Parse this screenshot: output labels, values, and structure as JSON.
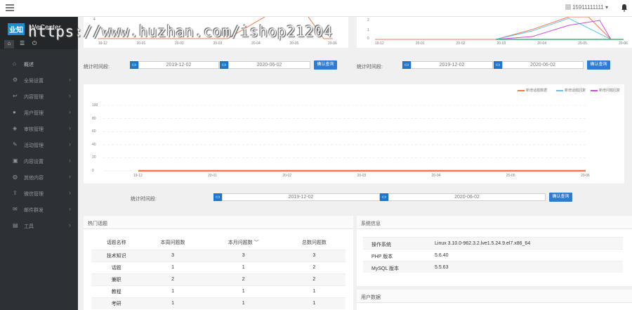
{
  "watermark": "https://www.huzhan.com/ishop21204",
  "brand": {
    "logo": "业知",
    "name": "WeCenter"
  },
  "user": {
    "name": "15911111111 ▾"
  },
  "sidebar": {
    "items": [
      {
        "label": "概述",
        "icon": "home-icon",
        "arrow": ""
      },
      {
        "label": "全局设置",
        "icon": "gear-icon",
        "arrow": "›"
      },
      {
        "label": "内容管理",
        "icon": "reply-icon",
        "arrow": "›"
      },
      {
        "label": "用户管理",
        "icon": "user-icon",
        "arrow": "›"
      },
      {
        "label": "审核管理",
        "icon": "shield-icon",
        "arrow": "›"
      },
      {
        "label": "活动管理",
        "icon": "edit-icon",
        "arrow": "›"
      },
      {
        "label": "内容设置",
        "icon": "trash-icon",
        "arrow": "›"
      },
      {
        "label": "其他内容",
        "icon": "globe-icon",
        "arrow": "›"
      },
      {
        "label": "微信管理",
        "icon": "share-icon",
        "arrow": "›"
      },
      {
        "label": "邮件群发",
        "icon": "mail-icon",
        "arrow": "›"
      },
      {
        "label": "工具",
        "icon": "toolbox-icon",
        "arrow": "›"
      }
    ]
  },
  "filters": {
    "label": "统计时间段:",
    "start": "2019-12-02",
    "end": "2020-06-02",
    "button": "确认查询"
  },
  "charts": {
    "top_left_ticks": [
      "19-12",
      "20-01",
      "20-02",
      "20-03",
      "20-04",
      "20-05",
      "20-06"
    ],
    "top_left_y": [
      "4"
    ],
    "top_right_ticks": [
      "19-12",
      "20-01",
      "20-02",
      "20-03",
      "20-04",
      "20-05",
      "20-06"
    ],
    "top_right_y": [
      "2",
      "1",
      "0"
    ],
    "main_y": [
      "100",
      "80",
      "60",
      "40",
      "20",
      "0"
    ],
    "main_x": [
      "19-12",
      "20-01",
      "20-02",
      "20-03",
      "20-04",
      "20-05",
      "20-06"
    ],
    "legend": [
      "新增话题数据",
      "新增话题回复",
      "新增问题回复"
    ],
    "colors": {
      "orange": "#f2784b",
      "cyan": "#62c3e8",
      "purple": "#c44fd0",
      "green": "#3cb371"
    }
  },
  "chart_data": {
    "type": "line",
    "categories": [
      "19-12",
      "20-01",
      "20-02",
      "20-03",
      "20-04",
      "20-05",
      "20-06"
    ],
    "series": [
      {
        "name": "新增话题数据",
        "values": [
          0,
          0,
          0,
          0,
          0,
          0,
          0
        ]
      },
      {
        "name": "新增话题回复",
        "values": [
          0,
          0,
          0,
          0,
          0,
          0,
          0
        ]
      },
      {
        "name": "新增问题回复",
        "values": [
          0,
          0,
          0,
          0,
          0,
          0,
          0
        ]
      }
    ],
    "ylim": [
      0,
      100
    ]
  },
  "hot_topics": {
    "title": "热门话题",
    "headers": [
      "话题名称",
      "本周问题数",
      "本月问题数 ﹀",
      "总数问题数"
    ],
    "rows": [
      [
        "技术知识",
        "3",
        "3",
        "3"
      ],
      [
        "话题",
        "1",
        "1",
        "2"
      ],
      [
        "兼职",
        "2",
        "2",
        "2"
      ],
      [
        "教程",
        "1",
        "1",
        "1"
      ],
      [
        "考研",
        "1",
        "1",
        "1"
      ]
    ]
  },
  "system": {
    "title": "系统信息",
    "rows": [
      {
        "k": "操作系统",
        "v": "Linux 3.10.0-962.3.2.lve1.5.24.9.el7.x86_64"
      },
      {
        "k": "PHP 版本",
        "v": "5.6.40"
      },
      {
        "k": "MySQL 版本",
        "v": "5.5.63"
      }
    ]
  },
  "user_stats": {
    "title": "用户数据"
  }
}
